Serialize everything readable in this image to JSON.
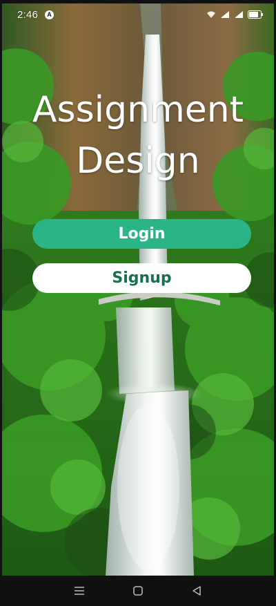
{
  "status_bar": {
    "time": "2:46",
    "notification_badge": "A",
    "icons": [
      "wifi-icon",
      "signal-icon",
      "signal-icon",
      "battery-icon"
    ]
  },
  "screen": {
    "title": "Assignment Design",
    "background": "waterfall-photo"
  },
  "buttons": {
    "login_label": "Login",
    "signup_label": "Signup"
  },
  "nav_bar": {
    "icons": [
      "menu-icon",
      "home-icon",
      "back-icon"
    ]
  },
  "colors": {
    "login_bg": "#2bb586",
    "login_text": "#ffffff",
    "signup_bg": "#ffffff",
    "signup_text": "#16704f",
    "title_text": "#ffffff"
  }
}
